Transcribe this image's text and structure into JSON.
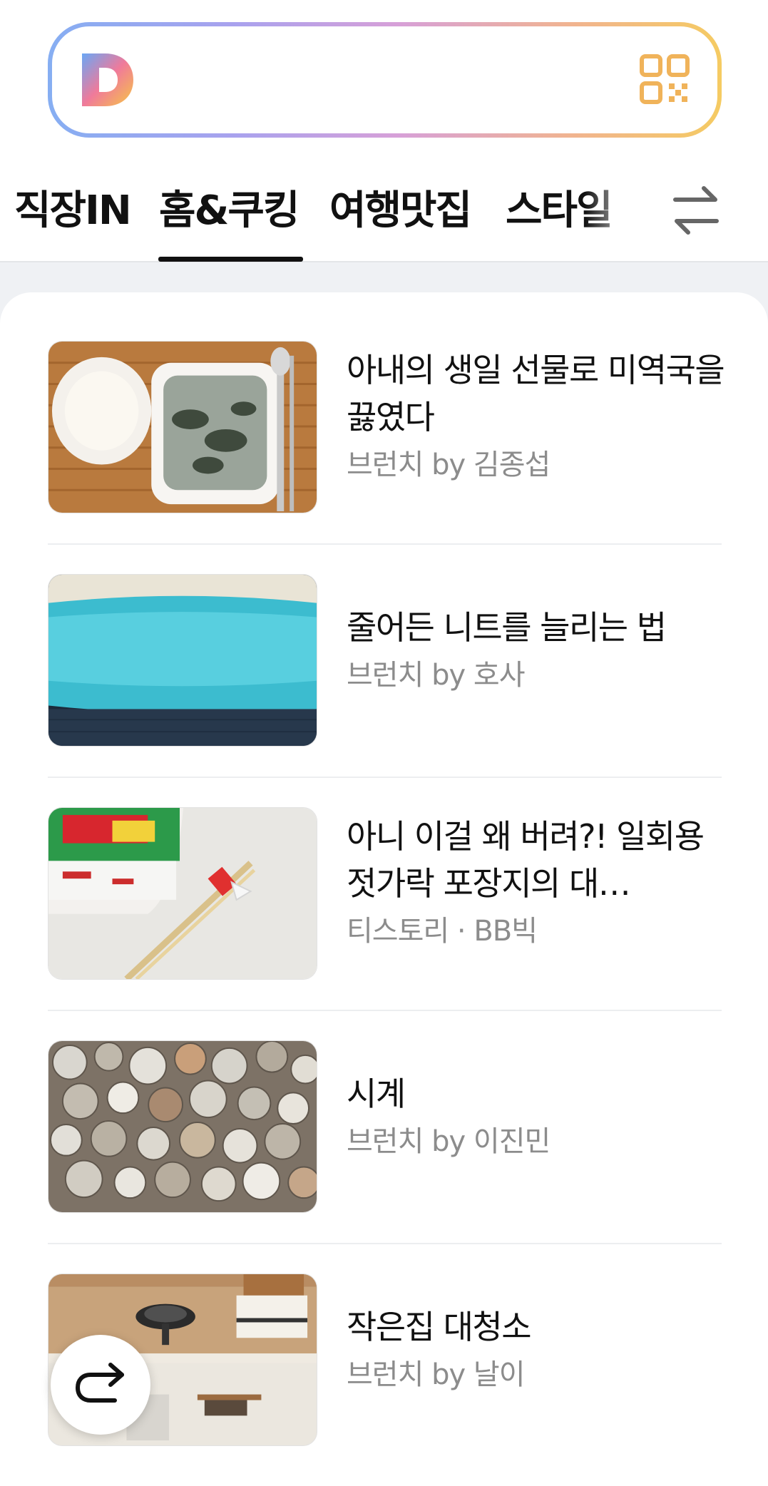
{
  "search": {
    "logo_icon": "daum-d-logo-icon",
    "qr_icon": "qr-code-icon",
    "gradient_colors": [
      "#86aef2",
      "#d7a0d8",
      "#f5cb62"
    ]
  },
  "tabs": {
    "items": [
      "직장IN",
      "홈&쿠킹",
      "여행맛집",
      "스타일"
    ],
    "active": "홈&쿠킹",
    "swap_icon": "swap-arrows-icon"
  },
  "articles": [
    {
      "title": "아내의 생일 선물로 미역국을 끓였다",
      "source": "브런치 by 김종섭",
      "thumb": "seaweed-soup-and-rice"
    },
    {
      "title": "줄어든 니트를 늘리는 법",
      "source": "브런치 by 호사",
      "thumb": "folded-knit-sweaters"
    },
    {
      "title": "아니 이걸 왜 버려?! 일회용 젓가락 포장지의 대…",
      "source": "티스토리 · BB빅",
      "thumb": "cup-noodle-and-chopsticks"
    },
    {
      "title": "시계",
      "source": "브런치 by 이진민",
      "thumb": "pile-of-watches"
    },
    {
      "title": "작은집 대청소",
      "source": "브런치 by 날이",
      "thumb": "tidy-kitchen-shelf"
    }
  ],
  "share_button_icon": "share-arrow-icon"
}
